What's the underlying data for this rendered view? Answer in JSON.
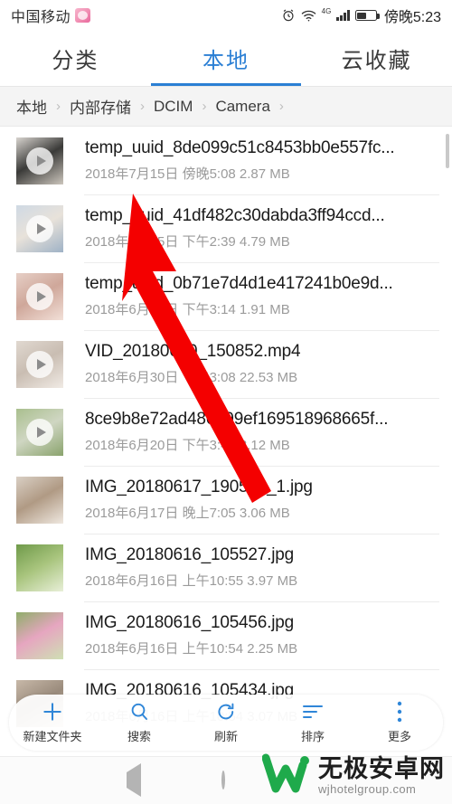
{
  "statusbar": {
    "carrier": "中国移动",
    "carrier_badge_icon": "pink-app-badge-icon",
    "alarm_icon": "alarm-clock-icon",
    "wifi_icon": "wifi-icon",
    "network_type": "4G",
    "signal_icon": "signal-bars-icon",
    "battery_icon": "battery-half-icon",
    "time": "傍晚5:23"
  },
  "tabs": [
    {
      "label": "分类",
      "active": false
    },
    {
      "label": "本地",
      "active": true
    },
    {
      "label": "云收藏",
      "active": false
    }
  ],
  "breadcrumb": {
    "separator": "›",
    "items": [
      "本地",
      "内部存储",
      "DCIM",
      "Camera"
    ]
  },
  "files": [
    {
      "name": "temp_uuid_8de099c51c8453bb0e557fc...",
      "date": "2018年7月15日",
      "time": "傍晚5:08",
      "size": "2.87 MB",
      "kind": "video"
    },
    {
      "name": "temp_uuid_41df482c30dabda3ff94ccd...",
      "date": "2018年7月15日",
      "time": "下午2:39",
      "size": "4.79 MB",
      "kind": "video"
    },
    {
      "name": "temp_uuid_0b71e7d4d1e417241b0e9d...",
      "date": "2018年6月30日",
      "time": "下午3:14",
      "size": "1.91 MB",
      "kind": "video"
    },
    {
      "name": "VID_20180630_150852.mp4",
      "date": "2018年6月30日",
      "time": "下午3:08",
      "size": "22.53 MB",
      "kind": "video"
    },
    {
      "name": "8ce9b8e72ad486799ef169518968665f...",
      "date": "2018年6月20日",
      "time": "下午3:43",
      "size": "3.12 MB",
      "kind": "video"
    },
    {
      "name": "IMG_20180617_190503_1.jpg",
      "date": "2018年6月17日",
      "time": "晚上7:05",
      "size": "3.06 MB",
      "kind": "image"
    },
    {
      "name": "IMG_20180616_105527.jpg",
      "date": "2018年6月16日",
      "time": "上午10:55",
      "size": "3.97 MB",
      "kind": "image"
    },
    {
      "name": "IMG_20180616_105456.jpg",
      "date": "2018年6月16日",
      "time": "上午10:54",
      "size": "2.25 MB",
      "kind": "image"
    },
    {
      "name": "IMG_20180616_105434.jpg",
      "date": "2018年6月16日",
      "time": "上午10:54",
      "size": "3.07 MB",
      "kind": "image"
    }
  ],
  "toolbar": [
    {
      "label": "新建文件夹",
      "icon": "plus-icon"
    },
    {
      "label": "搜索",
      "icon": "search-icon"
    },
    {
      "label": "刷新",
      "icon": "refresh-icon"
    },
    {
      "label": "排序",
      "icon": "sort-lines-icon"
    },
    {
      "label": "更多",
      "icon": "more-vertical-icon"
    }
  ],
  "navbar": {
    "back_icon": "back-triangle-icon",
    "home_icon": "home-circle-icon"
  },
  "watermark": {
    "logo_icon": "w-logo-icon",
    "title": "无极安卓网",
    "url": "wjhotelgroup.com"
  },
  "colors": {
    "accent": "#2b7fd4",
    "toolbar_icon": "#2f86d8",
    "arrow": "#f40000",
    "watermark_green": "#1faa4b"
  },
  "annotation": {
    "arrow_icon": "red-pointer-arrow-icon"
  }
}
